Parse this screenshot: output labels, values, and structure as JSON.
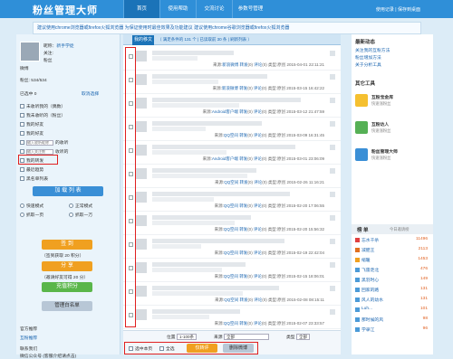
{
  "header": {
    "logo": "粉丝管理大师",
    "nav": [
      "首页",
      "使用帮助",
      "交流讨论",
      "参数号管理"
    ],
    "links": "使用记录 | 保存到桌面"
  },
  "notice": "建议使用chrome浏览器或firefox火狐浏览器 为保证使用时最佳效果及功能建议 建议使用chrome谷歌浏览器或firefox火狐浏览器",
  "sidebar": {
    "nickname_label": "昵称：",
    "nickname": "新手学徒",
    "follow_label": "关注:",
    "fans_label": "粉丝",
    "weibo_label": "微博",
    "fans_count": "534/534",
    "selected_label": "已选中 0",
    "cancel_label": "取消选择",
    "options": [
      "未收听我的（偶数）",
      "我未收听的（粉丝）",
      "我的好友",
      "我的好友",
      "输入收听昵称",
      "输入关注数",
      "我的转发",
      "我的转发",
      "最近趋势",
      "黑名单列表"
    ],
    "nickname_placeholder": "输入收听昵称",
    "count_placeholder": "输入关注数",
    "field_label_1": "的收听",
    "field_label_2": "收听的",
    "load_button": "加 载 列 表",
    "radio1": "快速模式",
    "radio2": "正常模式",
    "radio3": "抓取一页",
    "radio4": "抓取一万",
    "sign_button": "签 到",
    "sign_info": "（签到获取 20 积分）",
    "share_button": "分 享",
    "share_info": "（邀请好友可得 20 分）",
    "recharge_button": "充值积分",
    "manage_button": "管理白名单",
    "official_label": "官方推荐",
    "app_label": "互粉推荐",
    "contact_label": "联系我们",
    "contact_info": "微信公众号 (客服介绍请点击)"
  },
  "main": {
    "tab": "我的移文",
    "tab_info": "（ 满足条件的 131 个 | 已读取前 30 条 | 刷新列表 ）",
    "rows": [
      {
        "source": "来源:",
        "platform": "新浪微博",
        "date": "2015-04-01 22:11:21"
      },
      {
        "source": "来源:",
        "platform": "新浪微博",
        "date": "2015-03-15 16:42:22"
      },
      {
        "source": "来源:",
        "platform": "Android客户端",
        "date": "2015-03-12 21:47:59"
      },
      {
        "source": "来源:",
        "platform": "QQ空间",
        "date": "2015-03-09 16:31:45"
      },
      {
        "source": "来源:",
        "platform": "Android客户端",
        "date": "2015-03-01 23:06:09"
      },
      {
        "source": "来源:",
        "platform": "QQ空间",
        "date": "2015-02-26 11:16:21"
      },
      {
        "source": "来源:",
        "platform": "QQ空间",
        "date": "2015-02-20 17:06:55"
      },
      {
        "source": "来源:",
        "platform": "QQ空间",
        "date": "2015-02-20 15:56:32"
      },
      {
        "source": "来源:",
        "platform": "QQ空间",
        "date": "2015-02-19 22:42:04"
      },
      {
        "source": "来源:",
        "platform": "QQ空间",
        "date": "2015-02-15 18:06:01"
      },
      {
        "source": "来源:",
        "platform": "QQ空间",
        "date": "2015-02-08 08:15:11"
      },
      {
        "source": "来源:",
        "platform": "QQ空间",
        "date": "2015-02-07 23:33:57"
      }
    ],
    "forward_label": "转发",
    "comment_label": "评论",
    "type_label": "类型:原创",
    "footer": {
      "pos_label": "位置",
      "pos_value": "1-100条",
      "source_label": "来源",
      "source_value": "全部",
      "type_label": "类型",
      "type_value": "全部",
      "select_page": "选中本页",
      "select_all": "全选",
      "action_button": "仅转评",
      "delete_button": "删除微博"
    }
  },
  "right": {
    "news_title": "最新动态",
    "news": [
      "关注我的互粉方法",
      "粉丝增加方法",
      "关于分析工具"
    ],
    "tools_title": "其它工具",
    "tools": [
      {
        "name": "互粉宝金库",
        "desc": "快速涨粉丝"
      },
      {
        "name": "互粉达人",
        "desc": "快速涨粉丝"
      },
      {
        "name": "粉丝管理大师",
        "desc": "快速涨粉丝"
      }
    ],
    "rank_tab1": "榜 单",
    "rank_tab2": "今日邀请榜",
    "ranks": [
      {
        "name": "忘水千杀",
        "count": "11496"
      },
      {
        "name": "减肥王",
        "count": "2113"
      },
      {
        "name": "缩暖",
        "count": "1453"
      },
      {
        "name": "飞雷走北",
        "count": "476"
      },
      {
        "name": "黑羽时心",
        "count": "149"
      },
      {
        "name": "回家的路",
        "count": "131"
      },
      {
        "name": "风人的幼水",
        "count": "131"
      },
      {
        "name": "Luh...",
        "count": "101"
      },
      {
        "name": "那时候的风",
        "count": "98"
      },
      {
        "name": "学录江",
        "count": "96"
      }
    ],
    "rank_colors": [
      "#e04040",
      "#e07020",
      "#f0a020",
      "#4a9ad8",
      "#4a9ad8",
      "#4a9ad8",
      "#4a9ad8",
      "#4a9ad8",
      "#4a9ad8",
      "#4a9ad8"
    ]
  }
}
